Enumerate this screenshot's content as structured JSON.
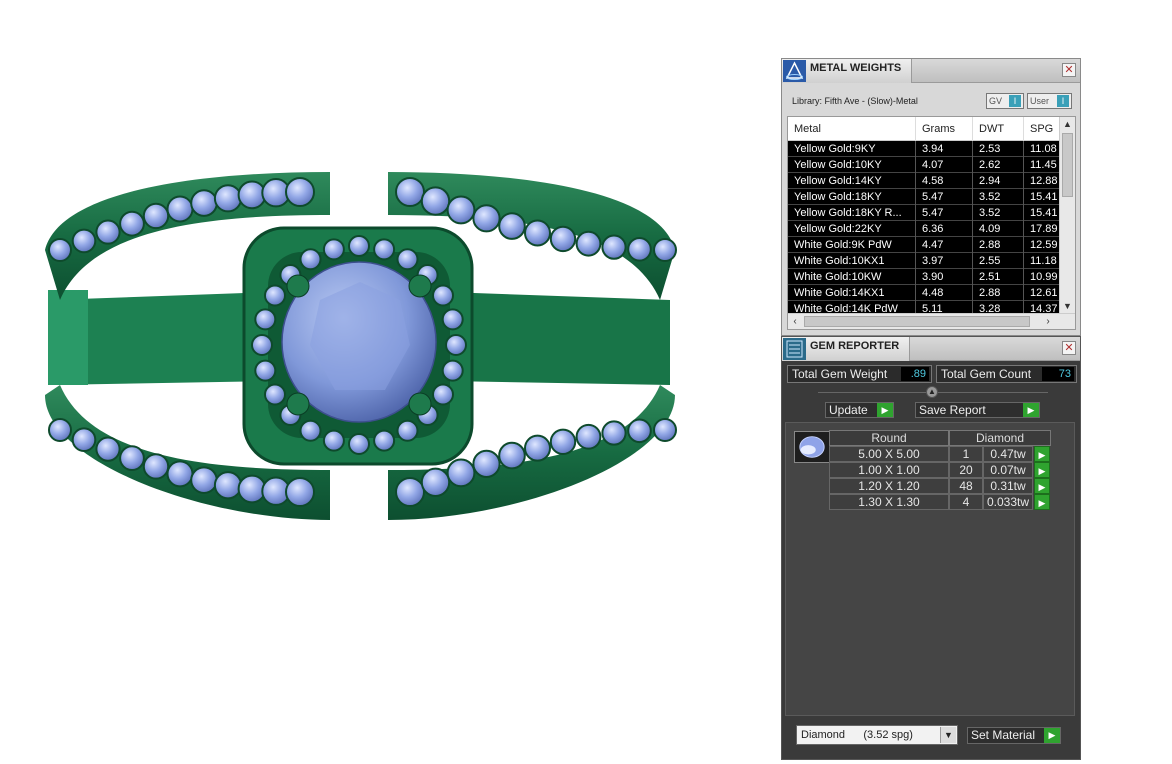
{
  "metal_weights": {
    "title": "METAL WEIGHTS",
    "library": "Library: Fifth Ave - (Slow)-Metal",
    "toggles": [
      {
        "label": "GV"
      },
      {
        "label": "User"
      }
    ],
    "columns": [
      "Metal",
      "Grams",
      "DWT",
      "SPG"
    ],
    "rows": [
      [
        "Yellow Gold:9KY",
        "3.94",
        "2.53",
        "11.08"
      ],
      [
        "Yellow Gold:10KY",
        "4.07",
        "2.62",
        "11.45"
      ],
      [
        "Yellow Gold:14KY",
        "4.58",
        "2.94",
        "12.88"
      ],
      [
        "Yellow Gold:18KY",
        "5.47",
        "3.52",
        "15.41"
      ],
      [
        "Yellow Gold:18KY R...",
        "5.47",
        "3.52",
        "15.41"
      ],
      [
        "Yellow Gold:22KY",
        "6.36",
        "4.09",
        "17.89"
      ],
      [
        "White Gold:9K PdW",
        "4.47",
        "2.88",
        "12.59"
      ],
      [
        "White Gold:10KX1",
        "3.97",
        "2.55",
        "11.18"
      ],
      [
        "White Gold:10KW",
        "3.90",
        "2.51",
        "10.99"
      ],
      [
        "White Gold:14KX1",
        "4.48",
        "2.88",
        "12.61"
      ],
      [
        "White Gold:14K PdW",
        "5.11",
        "3.28",
        "14.37"
      ]
    ]
  },
  "gem_reporter": {
    "title": "GEM REPORTER",
    "total_weight_label": "Total Gem Weight",
    "total_weight_value": ".89",
    "total_count_label": "Total Gem Count",
    "total_count_value": "73",
    "update_label": "Update",
    "save_label": "Save Report",
    "gem_shape": "Round",
    "gem_material": "Diamond",
    "gems": [
      {
        "size": "5.00 X 5.00",
        "count": "1",
        "weight": "0.47tw"
      },
      {
        "size": "1.00 X 1.00",
        "count": "20",
        "weight": "0.07tw"
      },
      {
        "size": "1.20 X 1.20",
        "count": "48",
        "weight": "0.31tw"
      },
      {
        "size": "1.30 X 1.30",
        "count": "4",
        "weight": "0.033tw"
      }
    ],
    "material_select": "Diamond      (3.52 spg)",
    "set_material_label": "Set Material"
  },
  "icons": {
    "metal_panel": "pyramid-icon",
    "gem_panel": "gem-report-icon",
    "close": "close-icon",
    "play": "play-icon",
    "gem_thumb": "gem-thumbnail-icon"
  },
  "colors": {
    "metal": "#1f7a4d",
    "gem": "#7f9be0",
    "accent_green": "#2fa32f",
    "value_cyan": "#4fc9e0"
  }
}
